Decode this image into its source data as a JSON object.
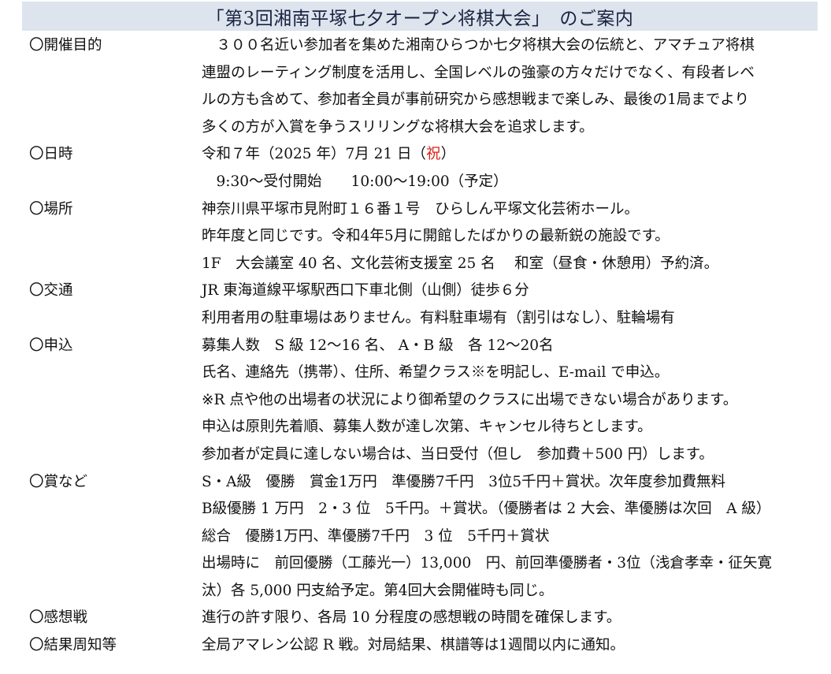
{
  "colors": {
    "title_band": "#dde4ee",
    "title_text": "#1a2340",
    "body_text": "#111111",
    "holiday_red": "#d8261c"
  },
  "title": "「第3回湘南平塚七夕オープン将棋大会」　のご案内",
  "sections": {
    "purpose": {
      "label": "〇開催目的",
      "lines": [
        "　３００名近い参加者を集めた湘南ひらつか七夕将棋大会の伝統と、アマチュア将棋",
        "連盟のレーティング制度を活用し、全国レベルの強豪の方々だけでなく、有段者レベ",
        "ルの方も含めて、参加者全員が事前研究から感想戦まで楽しみ、最後の1局までより",
        "多くの方が入賞を争うスリリングな将棋大会を追求します。"
      ]
    },
    "datetime": {
      "label": "〇日時",
      "date_before": "令和７年（2025 年）7月 21 日（",
      "date_holiday": "祝",
      "date_after": "）",
      "time_line": "　9:30～受付開始　　10:00～19:00（予定）"
    },
    "venue": {
      "label": "〇場所",
      "lines": [
        "神奈川県平塚市見附町１６番１号　ひらしん平塚文化芸術ホール。",
        "昨年度と同じです。令和4年5月に開館したばかりの最新鋭の施設です。",
        "1F　大会議室 40 名、文化芸術支援室 25 名　 和室（昼食・休憩用）予約済。"
      ]
    },
    "access": {
      "label": "〇交通",
      "lines": [
        "JR 東海道線平塚駅西口下車北側（山側）徒歩６分",
        "利用者用の駐車場はありません。有料駐車場有（割引はなし）、駐輪場有"
      ]
    },
    "application": {
      "label": "〇申込",
      "lines": [
        "募集人数　S 級 12～16 名、 A・B 級　各 12～20名",
        "氏名、連絡先（携帯）、住所、希望クラス※を明記し、E-mail で申込。",
        "※R 点や他の出場者の状況により御希望のクラスに出場できない場合があります。",
        "申込は原則先着順、募集人数が達し次第、キャンセル待ちとします。",
        "参加者が定員に達しない場合は、当日受付（但し　参加費＋500 円）します。"
      ]
    },
    "prizes": {
      "label": "〇賞など",
      "lines": [
        "S・A級　優勝　賞金1万円　準優勝7千円　3位5千円＋賞状。次年度参加費無料",
        "B級優勝 1 万円　2・3 位　5千円。＋賞状。（優勝者は 2 大会、準優勝は次回　A 級）",
        "総合　優勝1万円、準優勝7千円　3 位　5千円＋賞状",
        "出場時に　前回優勝（工藤光一）13,000　円、前回準優勝者・3位（浅倉孝幸・征矢寛",
        "汰）各 5,000 円支給予定。第4回大会開催時も同じ。"
      ]
    },
    "review": {
      "label": "〇感想戦",
      "lines": [
        "進行の許す限り、各局 10 分程度の感想戦の時間を確保します。"
      ]
    },
    "results": {
      "label": "〇結果周知等",
      "lines": [
        "全局アマレン公認 R 戦。対局結果、棋譜等は1週間以内に通知。"
      ]
    }
  }
}
